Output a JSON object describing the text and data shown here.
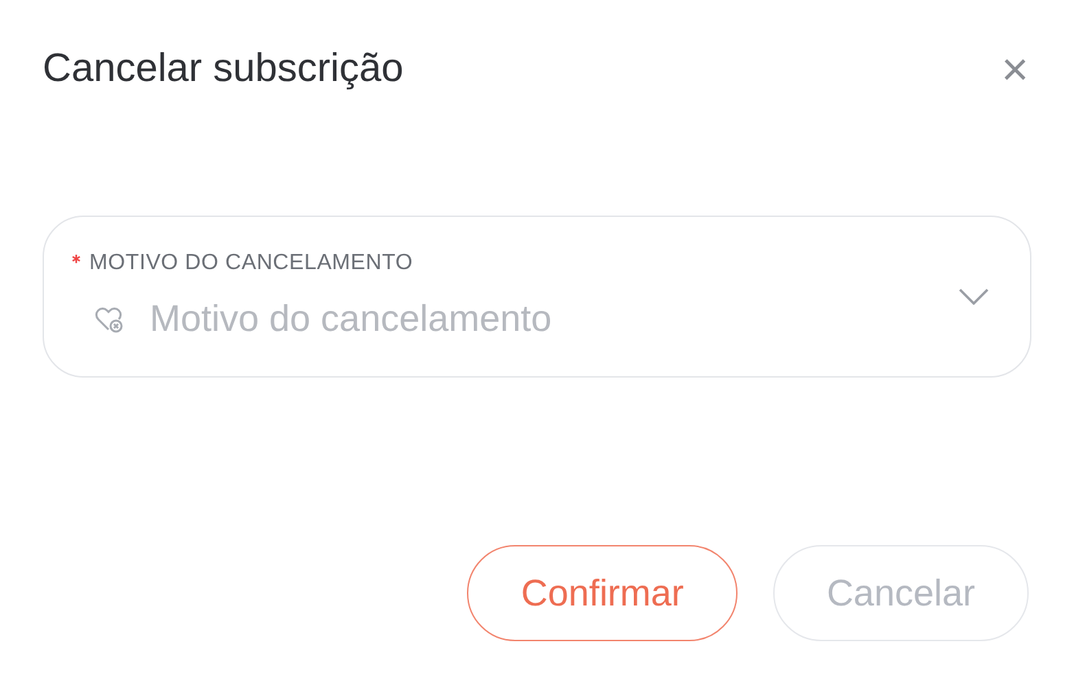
{
  "dialog": {
    "title": "Cancelar subscrição",
    "close": "×"
  },
  "field": {
    "label": "MOTIVO DO CANCELAMENTO",
    "required": true,
    "placeholder": "Motivo do cancelamento"
  },
  "buttons": [
    {
      "label": "Confirmar",
      "kind": "primary"
    },
    {
      "label": "Cancelar",
      "kind": "secondary"
    }
  ]
}
